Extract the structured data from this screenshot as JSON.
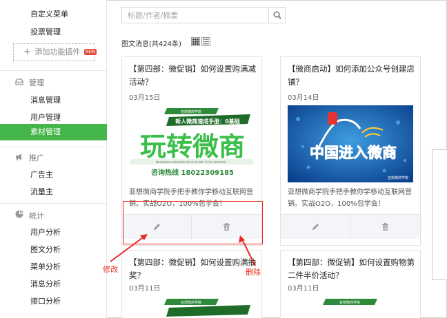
{
  "sidebar": {
    "custom_menu": "自定义菜单",
    "vote_manage": "投票管理",
    "add_plugin": "添加功能插件",
    "new_badge": "NEW",
    "sections": [
      {
        "title": "管理",
        "icon": "inbox-icon",
        "items": [
          "消息管理",
          "用户管理",
          "素材管理"
        ]
      },
      {
        "title": "推广",
        "icon": "megaphone-icon",
        "items": [
          "广告主",
          "流量主"
        ]
      },
      {
        "title": "统计",
        "icon": "pie-chart-icon",
        "items": [
          "用户分析",
          "图文分析",
          "菜单分析",
          "消息分析",
          "接口分析"
        ]
      }
    ],
    "active_item": "素材管理"
  },
  "search": {
    "placeholder": "标题/作者/摘要",
    "value": ""
  },
  "list_header": {
    "count_label": "图文消息(共424条)"
  },
  "cards": [
    {
      "title": "【第四部：微促销】如何设置购满减活动？",
      "date": "03月15日",
      "image": {
        "banner": "亚想微商学院",
        "subtitle": "新人微商速成手册：0基础",
        "headline": "玩转微商",
        "tagline": "Newcomers domestic Quick Guide: 0 Fun domestic",
        "phone": "咨询热线 18022309185"
      },
      "desc": "亚想微商学院手把手教你学移动互联网营销。实战O2O，100%包学会！"
    },
    {
      "title": "【微商启动】如何添加公众号创建店铺？",
      "date": "03月14日",
      "image": {
        "headline": "中国进入微商",
        "brand": "亚想微商学院"
      },
      "desc": "亚想微商学院手把手教你学移动互联网营销。实战O2O，100%包学会！"
    },
    {
      "title": "【第四部：微促销】如何设置购满抽奖？",
      "date": "03月11日",
      "image": {
        "banner": "亚想微商学院"
      }
    },
    {
      "title": "【第四部：微促销】如何设置购物第二件半价活动？",
      "date": "03月11日",
      "image": {
        "banner": "亚想微商学院"
      }
    }
  ],
  "annotations": {
    "edit": "修改",
    "delete": "删除",
    "color": "#e8281f"
  },
  "colors": {
    "accent": "#44b549",
    "annotation": "#e8281f"
  }
}
